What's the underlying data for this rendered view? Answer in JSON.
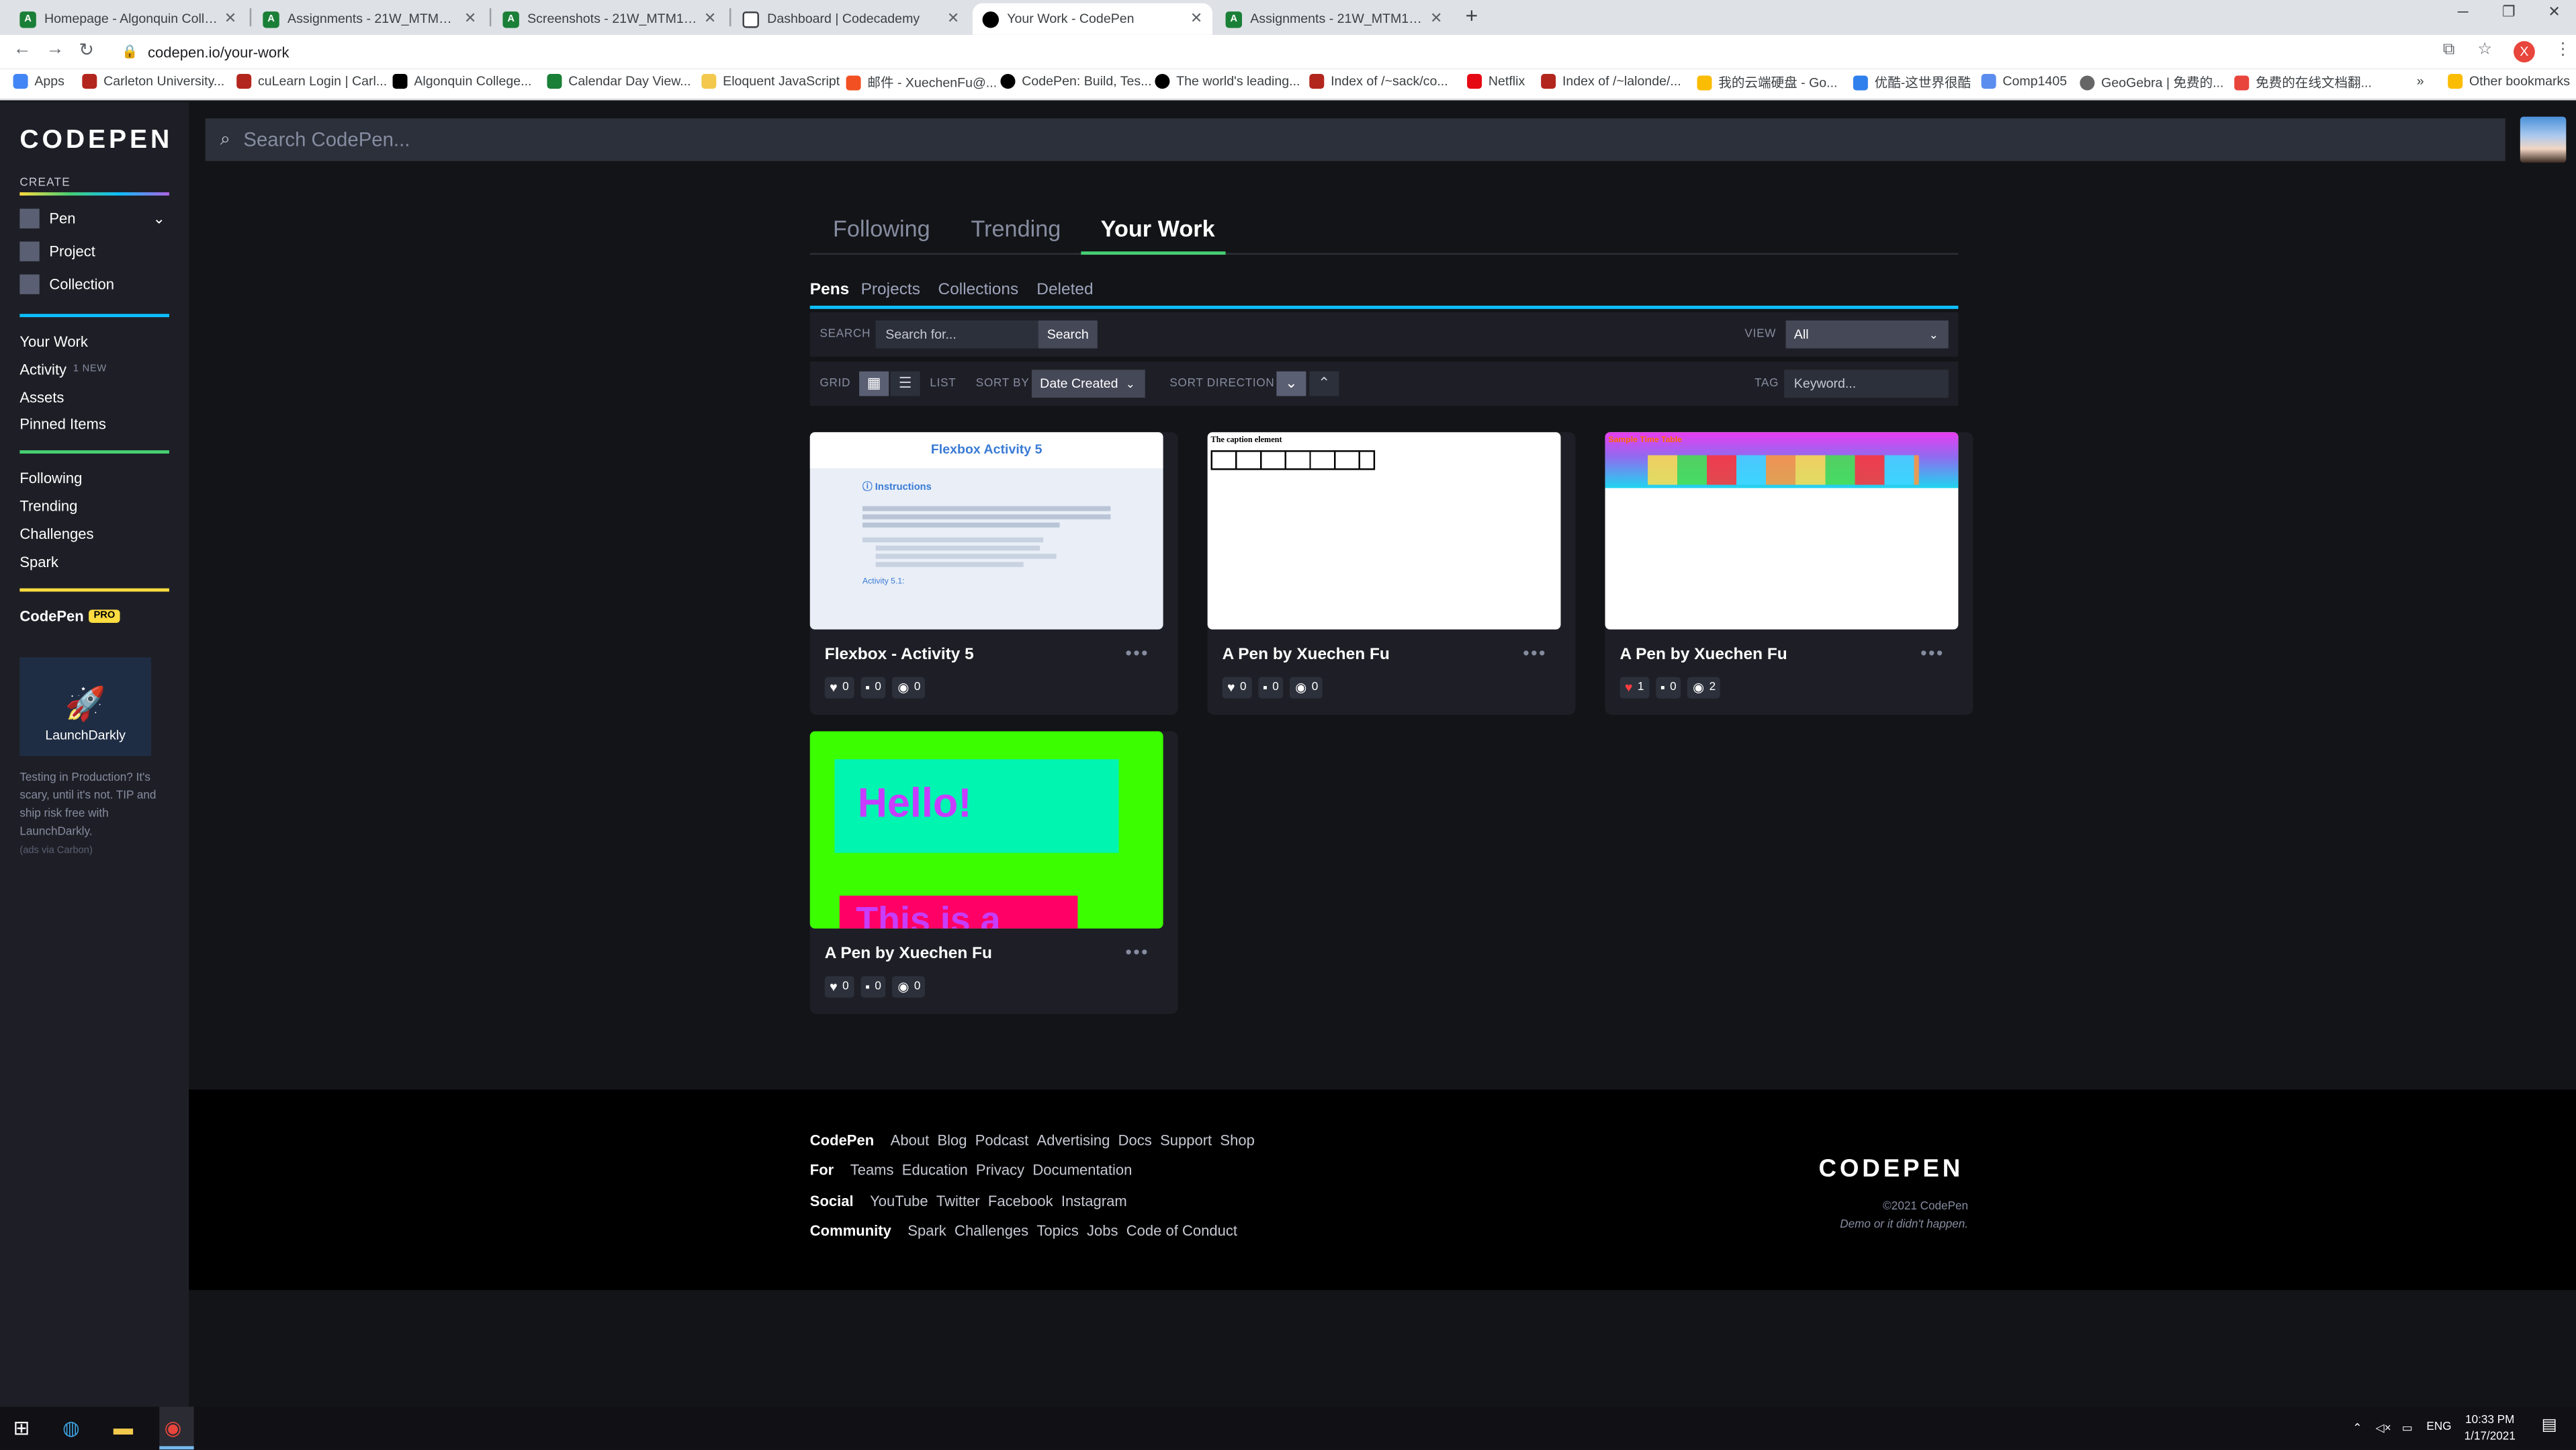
{
  "browser": {
    "tabs": [
      {
        "label": "Homepage - Algonquin College",
        "color": "#1a7f37"
      },
      {
        "label": "Assignments - 21W_MTM1526_3",
        "color": "#1a7f37"
      },
      {
        "label": "Screenshots - 21W_MTM1526_3",
        "color": "#1a7f37"
      },
      {
        "label": "Dashboard | Codecademy",
        "color": "#3c4043"
      },
      {
        "label": "Your Work - CodePen",
        "color": "#000000"
      },
      {
        "label": "Assignments - 21W_MTM1531_0",
        "color": "#1a7f37"
      }
    ],
    "new_tab": "+",
    "url": "codepen.io/your-work",
    "profile_initial": "X",
    "bookmarks": [
      "Apps",
      "Carleton University...",
      "cuLearn Login | Carl...",
      "Algonquin College...",
      "Calendar Day View...",
      "Eloquent JavaScript",
      "邮件 - XuechenFu@...",
      "CodePen: Build, Tes...",
      "The world's leading...",
      "Index of /~sack/co...",
      "Netflix",
      "Index of /~lalonde/...",
      "我的云端硬盘 - Go...",
      "优酷-这世界很酷",
      "Comp1405",
      "GeoGebra | 免费的...",
      "免费的在线文档翻...",
      "»",
      "Other bookmarks"
    ]
  },
  "sidebar": {
    "logo": "CODEPEN",
    "create_label": "CREATE",
    "create_items": [
      "Pen",
      "Project",
      "Collection"
    ],
    "nav1": [
      {
        "label": "Your Work"
      },
      {
        "label": "Activity",
        "badge": "1 NEW"
      },
      {
        "label": "Assets"
      },
      {
        "label": "Pinned Items"
      }
    ],
    "nav2": [
      "Following",
      "Trending",
      "Challenges",
      "Spark"
    ],
    "codepen_label": "CodePen",
    "pro_badge": "PRO",
    "ad": {
      "brand": "LaunchDarkly",
      "text": "Testing in Production? It's scary, until it's not. TIP and ship risk free with LaunchDarkly.",
      "via": "(ads via Carbon)"
    }
  },
  "search": {
    "placeholder": "Search CodePen..."
  },
  "main": {
    "tabs": [
      "Following",
      "Trending",
      "Your Work"
    ],
    "subtabs": [
      "Pens",
      "Projects",
      "Collections",
      "Deleted"
    ],
    "filters": {
      "search_label": "SEARCH",
      "search_placeholder": "Search for...",
      "search_button": "Search",
      "view_label": "VIEW",
      "view_value": "All",
      "grid_label": "GRID",
      "list_label": "LIST",
      "sort_by_label": "SORT BY",
      "sort_by_value": "Date Created",
      "sort_dir_label": "SORT DIRECTION",
      "tag_label": "TAG",
      "tag_placeholder": "Keyword..."
    },
    "pens": [
      {
        "title": "Flexbox - Activity 5",
        "likes": "0",
        "comments": "0",
        "views": "0",
        "thumb": "flexbox"
      },
      {
        "title": "A Pen by Xuechen Fu",
        "likes": "0",
        "comments": "0",
        "views": "0",
        "thumb": "caption"
      },
      {
        "title": "A Pen by Xuechen Fu",
        "likes": "1",
        "comments": "0",
        "views": "2",
        "thumb": "timetable"
      },
      {
        "title": "A Pen by Xuechen Fu",
        "likes": "0",
        "comments": "0",
        "views": "0",
        "thumb": "hello"
      }
    ],
    "thumb_text": {
      "flexbox_title": "Flexbox Activity 5",
      "flexbox_heading": "Instructions",
      "flexbox_sub": "Activity 5.1:",
      "caption_title": "The caption element",
      "timetable_title": "Sample Time Table",
      "hello_title": "Hello!",
      "hello_sub": "This is a"
    }
  },
  "footer": {
    "rows": [
      {
        "head": "CodePen",
        "links": [
          "About",
          "Blog",
          "Podcast",
          "Advertising",
          "Docs",
          "Support",
          "Shop"
        ]
      },
      {
        "head": "For",
        "links": [
          "Teams",
          "Education",
          "Privacy",
          "Documentation"
        ]
      },
      {
        "head": "Social",
        "links": [
          "YouTube",
          "Twitter",
          "Facebook",
          "Instagram"
        ]
      },
      {
        "head": "Community",
        "links": [
          "Spark",
          "Challenges",
          "Topics",
          "Jobs",
          "Code of Conduct"
        ]
      }
    ],
    "logo": "CODEPEN",
    "copyright": "©2021 CodePen",
    "tagline": "Demo or it didn't happen."
  },
  "taskbar": {
    "lang": "ENG",
    "time": "10:33 PM",
    "date": "1/17/2021"
  },
  "colors": {
    "green_accent": "#47cf73",
    "blue_accent": "#0ebeff",
    "yellow_accent": "#ffdd40"
  }
}
